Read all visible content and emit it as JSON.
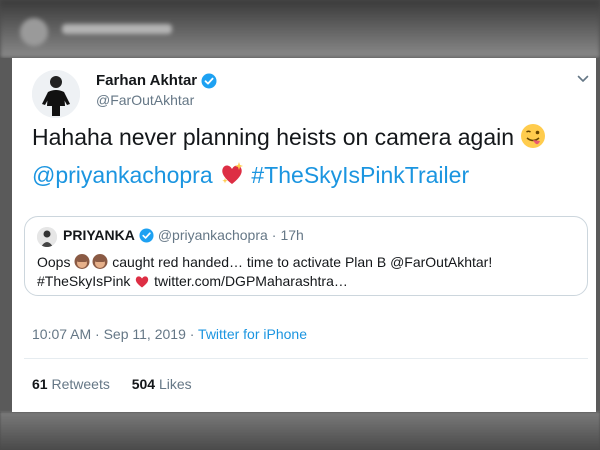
{
  "tweet": {
    "author": {
      "name": "Farhan Akhtar",
      "handle": "@FarOutAkhtar"
    },
    "text": {
      "line1": "Hahaha never planning heists on camera again",
      "mention": "@priyankachopra",
      "hashtag": "#TheSkyIsPink",
      "hashtag_trailer": "#TheSkyIsPinkTrailer"
    },
    "quoted": {
      "name": "PRIYANKA",
      "handle": "@priyankachopra",
      "separator": "·",
      "time": "17h",
      "line1_start": "Oops",
      "line1_end": "caught red handed… time to activate Plan B @FarOutAkhtar!",
      "line2_hashtag": "#TheSkyIsPink",
      "line2_link": "twitter.com/DGPMaharashtra…"
    },
    "meta": {
      "timestamp": "10:07 AM · Sep 11, 2019 ·",
      "source": "Twitter for iPhone"
    },
    "stats": {
      "retweets_count": "61",
      "retweets_label": "Retweets",
      "likes_count": "504",
      "likes_label": "Likes"
    }
  },
  "colors": {
    "link": "#1b95e0",
    "verified": "#1da1f2",
    "text": "#14171a",
    "muted": "#657786",
    "heart": "#e0245e"
  },
  "icons": [
    "verified-badge-icon",
    "chevron-down-icon",
    "winking-face-tongue-emoji",
    "sparkling-heart-emoji",
    "see-no-evil-monkey-emoji",
    "red-heart-emoji"
  ]
}
